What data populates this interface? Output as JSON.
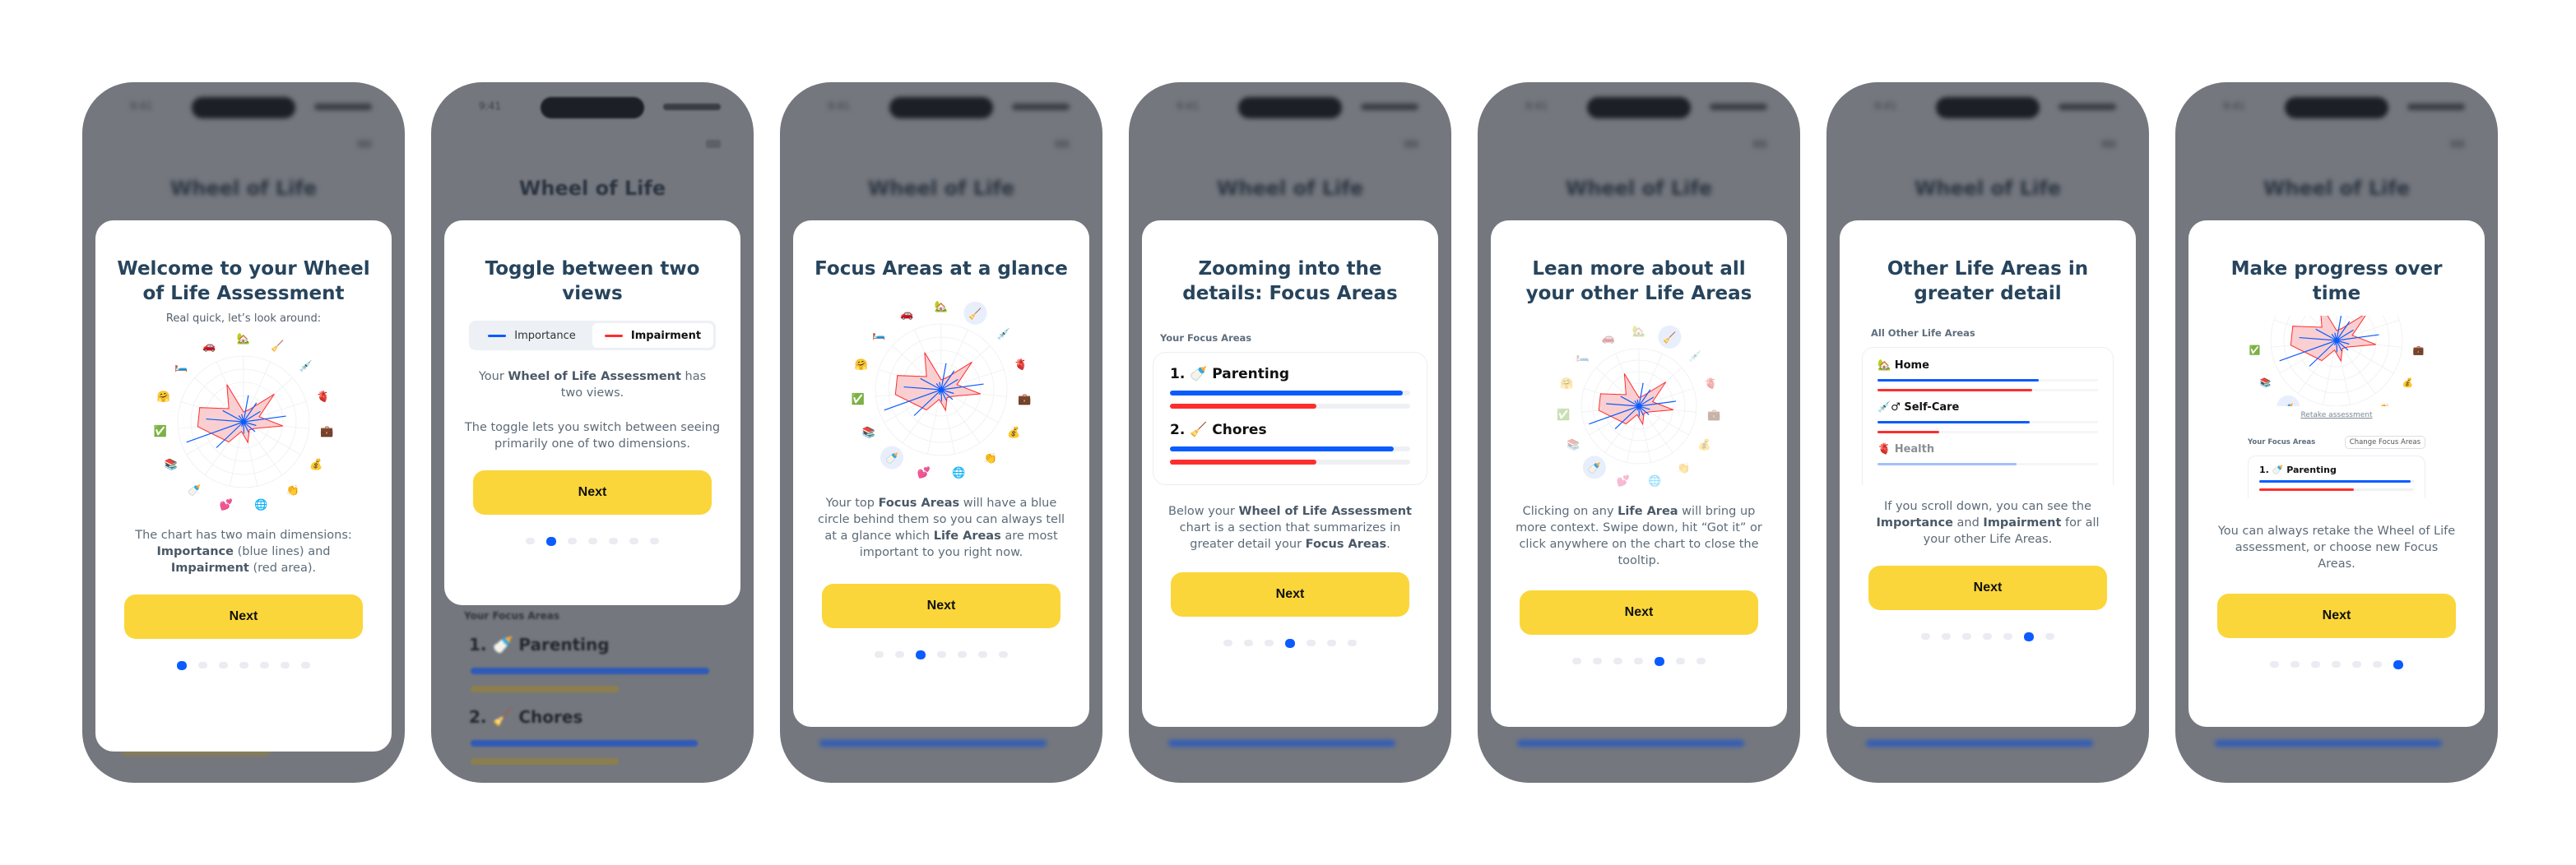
{
  "colors": {
    "importance": "#0a5cff",
    "impairment": "#ff2d2d",
    "impairment_fill": "#f9c7c9",
    "button": "#fbd63a",
    "title": "#27445c",
    "dot_active": "#0a5cff",
    "dot_inactive": "#eaecf1",
    "overlay": "#74777e"
  },
  "background": {
    "time": "9:41",
    "title": "Wheel of Life",
    "focus_label": "Your Focus Areas",
    "item1": "1. 🍼 Parenting",
    "item2": "2. 🧹 Chores"
  },
  "chart_data": {
    "type": "radar",
    "axes": [
      "🏡",
      "🧹",
      "💉",
      "🫀",
      "💼",
      "💰",
      "👏",
      "🌐",
      "💕",
      "🍼",
      "📚",
      "✅",
      "🤗",
      "🛏️",
      "🚗"
    ],
    "axis_icons": [
      "house-with-garden",
      "broom",
      "syringe",
      "anatomical-heart",
      "briefcase",
      "money-bag",
      "clapping-hands",
      "globe",
      "two-hearts",
      "baby-bottle",
      "books",
      "check-mark",
      "hugging-face",
      "bed",
      "car"
    ],
    "range": [
      0,
      10
    ],
    "series": [
      {
        "key": "importance",
        "style": "lines",
        "values": [
          4.1,
          3.5,
          3.0,
          6.5,
          2.0,
          2.3,
          1.8,
          1.8,
          0.8,
          5.7,
          9.2,
          5.7,
          3.6,
          1.2,
          1.2
        ]
      },
      {
        "key": "impairment",
        "style": "area",
        "values": [
          1.5,
          2.0,
          6.3,
          2.5,
          6.0,
          2.0,
          1.5,
          3.2,
          1.5,
          3.8,
          4.5,
          7.0,
          7.0,
          3.0,
          6.2
        ]
      }
    ],
    "focus_axes": [
      "🧹",
      "🍼"
    ],
    "grid": true
  },
  "slides": [
    {
      "title": "Welcome to your Wheel of Life Assessment",
      "subtitle": "Real quick, let’s look around:",
      "body": [
        {
          "t": "The chart has two main dimensions: "
        },
        {
          "t": "Importance",
          "b": true
        },
        {
          "t": " (blue lines) and "
        },
        {
          "t": "Impairment",
          "b": true
        },
        {
          "t": " (red area)."
        }
      ],
      "next": "Next",
      "active": 0
    },
    {
      "title": "Toggle between two views",
      "toggle": [
        "Importance",
        "Impairment"
      ],
      "toggle_selected": "Impairment",
      "body": [
        {
          "t": "Your "
        },
        {
          "t": "Wheel of Life Assessment",
          "b": true
        },
        {
          "t": " has two views."
        }
      ],
      "body2": "The toggle lets you switch between seeing primarily one of two dimensions.",
      "next": "Next",
      "active": 1
    },
    {
      "title": "Focus Areas at a glance",
      "body": [
        {
          "t": "Your top "
        },
        {
          "t": "Focus Areas",
          "b": true
        },
        {
          "t": " will have a blue circle behind them so you can always tell at a glance which "
        },
        {
          "t": "Life Areas",
          "b": true
        },
        {
          "t": " are most important to you right now."
        }
      ],
      "next": "Next",
      "active": 2
    },
    {
      "title": "Zooming into the details: Focus Areas",
      "section": "Your Focus Areas",
      "focus_areas": [
        {
          "label": "1. 🍼 Parenting",
          "importance": 0.97,
          "impairment": 0.61
        },
        {
          "label": "2. 🧹 Chores",
          "importance": 0.93,
          "impairment": 0.61
        }
      ],
      "body": [
        {
          "t": "Below your "
        },
        {
          "t": "Wheel of Life Assessment",
          "b": true
        },
        {
          "t": " chart is a section that summarizes in greater detail your "
        },
        {
          "t": "Focus Areas",
          "b": true
        },
        {
          "t": "."
        }
      ],
      "next": "Next",
      "active": 3
    },
    {
      "title": "Lean more about all your other Life Areas",
      "body": [
        {
          "t": "Clicking on any "
        },
        {
          "t": "Life Area",
          "b": true
        },
        {
          "t": " will bring up more context. Swipe down, hit “Got it” or click anywhere on the chart to close the tooltip."
        }
      ],
      "next": "Next",
      "active": 4
    },
    {
      "title": "Other Life Areas in greater detail",
      "section": "All Other Life Areas",
      "areas": [
        {
          "label": "🏡 Home",
          "importance": 0.73,
          "impairment": 0.7
        },
        {
          "label": "💉♂ Self-Care",
          "importance": 0.69,
          "impairment": 0.28
        },
        {
          "label": "🫀 Health",
          "importance": 0.63
        }
      ],
      "body": [
        {
          "t": "If you scroll down, you can see the "
        },
        {
          "t": "Importance",
          "b": true
        },
        {
          "t": " and "
        },
        {
          "t": "Impairment",
          "b": true
        },
        {
          "t": " for all your other Life Areas."
        }
      ],
      "next": "Next",
      "active": 5
    },
    {
      "title": "Make progress over time",
      "retake": "Retake assessment",
      "section": "Your Focus Areas",
      "change": "Change Focus Areas",
      "focus_areas": [
        {
          "label": "1. 🍼 Parenting",
          "importance": 0.98,
          "impairment": 0.61
        }
      ],
      "body": [
        {
          "t": "You can always retake the Wheel of Life assessment, or choose new Focus Areas."
        }
      ],
      "next": "Next",
      "active": 6
    }
  ],
  "dot_count": 7
}
